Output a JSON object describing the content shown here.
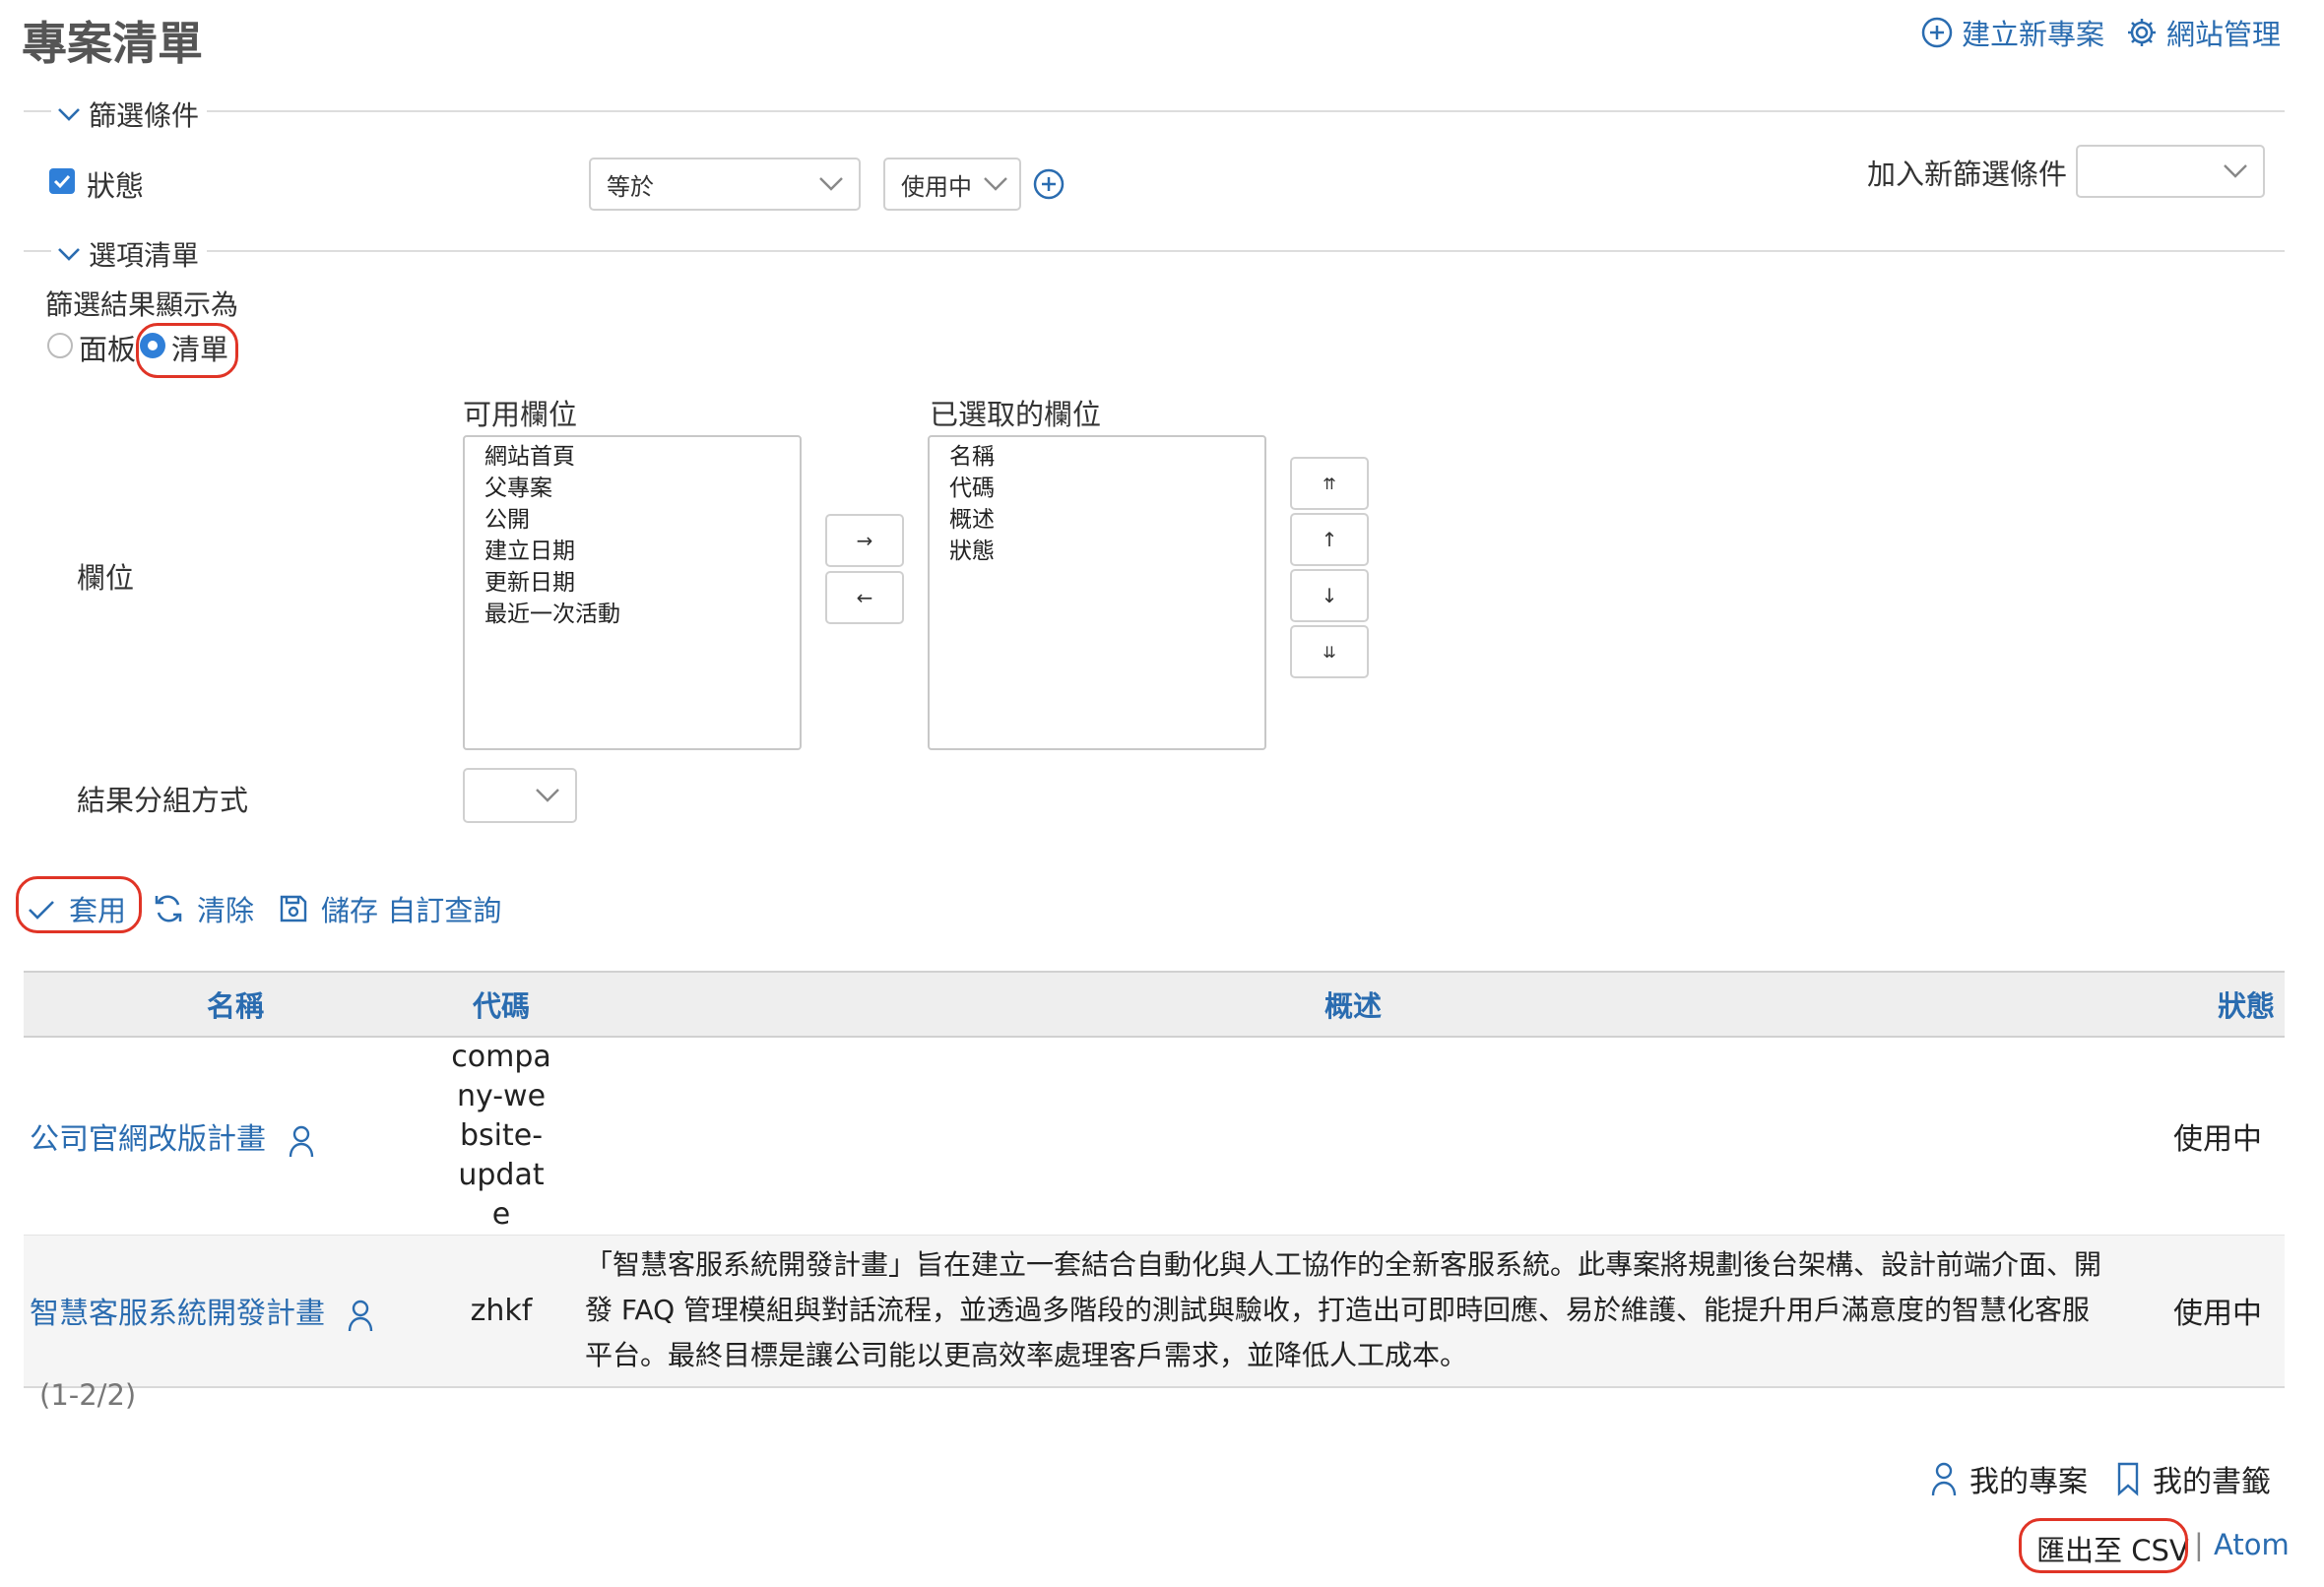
{
  "page": {
    "title": "專案清單"
  },
  "header_actions": {
    "new_project": "建立新專案",
    "admin": "網站管理"
  },
  "filters": {
    "section_title": "篩選條件",
    "status_label": "狀態",
    "status_checked": true,
    "operator": "等於",
    "value": "使用中",
    "add_filter_label": "加入新篩選條件",
    "add_filter_value": ""
  },
  "options": {
    "section_title": "選項清單",
    "display_as_label": "篩選結果顯示為",
    "display_board": "面板",
    "display_list": "清單",
    "columns_label": "欄位",
    "available_label": "可用欄位",
    "selected_label": "已選取的欄位",
    "available_columns": [
      "網站首頁",
      "父專案",
      "公開",
      "建立日期",
      "更新日期",
      "最近一次活動"
    ],
    "selected_columns": [
      "名稱",
      "代碼",
      "概述",
      "狀態"
    ],
    "move_right": "→",
    "move_left": "←",
    "order_top": "⇈",
    "order_up": "↑",
    "order_down": "↓",
    "order_bottom": "⇊",
    "group_by_label": "結果分組方式",
    "group_by_value": ""
  },
  "buttons": {
    "apply": "套用",
    "clear": "清除",
    "save": "儲存 自訂查詢"
  },
  "table": {
    "headers": {
      "name": "名稱",
      "code": "代碼",
      "description": "概述",
      "status": "狀態"
    },
    "rows": [
      {
        "name": "公司官網改版計畫",
        "code": "company-website-update",
        "description": "",
        "status": "使用中"
      },
      {
        "name": "智慧客服系統開發計畫",
        "code": "zhkf",
        "description": "「智慧客服系統開發計畫」旨在建立一套結合自動化與人工協作的全新客服系統。此專案將規劃後台架構、設計前端介面、開發 FAQ 管理模組與對話流程，並透過多階段的測試與驗收，打造出可即時回應、易於維護、能提升用戶滿意度的智慧化客服平台。最終目標是讓公司能以更高效率處理客戶需求，並降低人工成本。",
        "status": "使用中"
      }
    ]
  },
  "pagination": "(1-2/2)",
  "footer": {
    "my_projects": "我的專案",
    "my_bookmarks": "我的書籤",
    "export_csv": "匯出至 CSV",
    "separator": "|",
    "atom": "Atom"
  },
  "colors": {
    "link": "#2a6cb0",
    "highlight": "#e03426",
    "checkbox": "#2f7fd8",
    "header_bg": "#eeeeee"
  },
  "icons": [
    "plus-circle-icon",
    "gear-icon",
    "chevron-down-icon",
    "check-icon",
    "refresh-icon",
    "save-icon",
    "user-icon",
    "bookmark-icon"
  ]
}
